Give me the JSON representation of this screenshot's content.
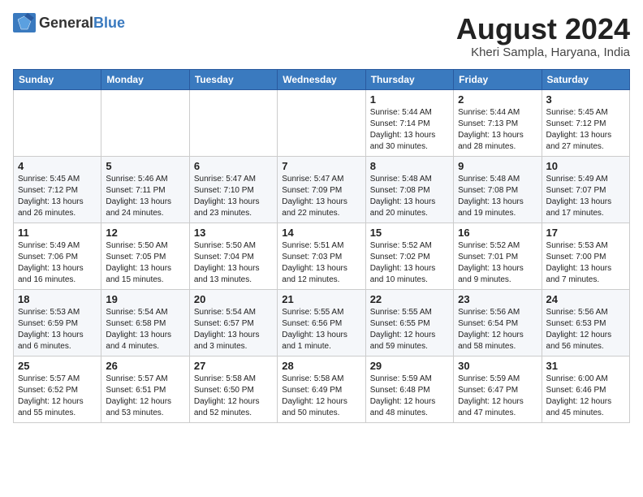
{
  "logo": {
    "text1": "General",
    "text2": "Blue"
  },
  "header": {
    "month_year": "August 2024",
    "location": "Kheri Sampla, Haryana, India"
  },
  "days_of_week": [
    "Sunday",
    "Monday",
    "Tuesday",
    "Wednesday",
    "Thursday",
    "Friday",
    "Saturday"
  ],
  "weeks": [
    [
      {
        "day": "",
        "content": ""
      },
      {
        "day": "",
        "content": ""
      },
      {
        "day": "",
        "content": ""
      },
      {
        "day": "",
        "content": ""
      },
      {
        "day": "1",
        "content": "Sunrise: 5:44 AM\nSunset: 7:14 PM\nDaylight: 13 hours\nand 30 minutes."
      },
      {
        "day": "2",
        "content": "Sunrise: 5:44 AM\nSunset: 7:13 PM\nDaylight: 13 hours\nand 28 minutes."
      },
      {
        "day": "3",
        "content": "Sunrise: 5:45 AM\nSunset: 7:12 PM\nDaylight: 13 hours\nand 27 minutes."
      }
    ],
    [
      {
        "day": "4",
        "content": "Sunrise: 5:45 AM\nSunset: 7:12 PM\nDaylight: 13 hours\nand 26 minutes."
      },
      {
        "day": "5",
        "content": "Sunrise: 5:46 AM\nSunset: 7:11 PM\nDaylight: 13 hours\nand 24 minutes."
      },
      {
        "day": "6",
        "content": "Sunrise: 5:47 AM\nSunset: 7:10 PM\nDaylight: 13 hours\nand 23 minutes."
      },
      {
        "day": "7",
        "content": "Sunrise: 5:47 AM\nSunset: 7:09 PM\nDaylight: 13 hours\nand 22 minutes."
      },
      {
        "day": "8",
        "content": "Sunrise: 5:48 AM\nSunset: 7:08 PM\nDaylight: 13 hours\nand 20 minutes."
      },
      {
        "day": "9",
        "content": "Sunrise: 5:48 AM\nSunset: 7:08 PM\nDaylight: 13 hours\nand 19 minutes."
      },
      {
        "day": "10",
        "content": "Sunrise: 5:49 AM\nSunset: 7:07 PM\nDaylight: 13 hours\nand 17 minutes."
      }
    ],
    [
      {
        "day": "11",
        "content": "Sunrise: 5:49 AM\nSunset: 7:06 PM\nDaylight: 13 hours\nand 16 minutes."
      },
      {
        "day": "12",
        "content": "Sunrise: 5:50 AM\nSunset: 7:05 PM\nDaylight: 13 hours\nand 15 minutes."
      },
      {
        "day": "13",
        "content": "Sunrise: 5:50 AM\nSunset: 7:04 PM\nDaylight: 13 hours\nand 13 minutes."
      },
      {
        "day": "14",
        "content": "Sunrise: 5:51 AM\nSunset: 7:03 PM\nDaylight: 13 hours\nand 12 minutes."
      },
      {
        "day": "15",
        "content": "Sunrise: 5:52 AM\nSunset: 7:02 PM\nDaylight: 13 hours\nand 10 minutes."
      },
      {
        "day": "16",
        "content": "Sunrise: 5:52 AM\nSunset: 7:01 PM\nDaylight: 13 hours\nand 9 minutes."
      },
      {
        "day": "17",
        "content": "Sunrise: 5:53 AM\nSunset: 7:00 PM\nDaylight: 13 hours\nand 7 minutes."
      }
    ],
    [
      {
        "day": "18",
        "content": "Sunrise: 5:53 AM\nSunset: 6:59 PM\nDaylight: 13 hours\nand 6 minutes."
      },
      {
        "day": "19",
        "content": "Sunrise: 5:54 AM\nSunset: 6:58 PM\nDaylight: 13 hours\nand 4 minutes."
      },
      {
        "day": "20",
        "content": "Sunrise: 5:54 AM\nSunset: 6:57 PM\nDaylight: 13 hours\nand 3 minutes."
      },
      {
        "day": "21",
        "content": "Sunrise: 5:55 AM\nSunset: 6:56 PM\nDaylight: 13 hours\nand 1 minute."
      },
      {
        "day": "22",
        "content": "Sunrise: 5:55 AM\nSunset: 6:55 PM\nDaylight: 12 hours\nand 59 minutes."
      },
      {
        "day": "23",
        "content": "Sunrise: 5:56 AM\nSunset: 6:54 PM\nDaylight: 12 hours\nand 58 minutes."
      },
      {
        "day": "24",
        "content": "Sunrise: 5:56 AM\nSunset: 6:53 PM\nDaylight: 12 hours\nand 56 minutes."
      }
    ],
    [
      {
        "day": "25",
        "content": "Sunrise: 5:57 AM\nSunset: 6:52 PM\nDaylight: 12 hours\nand 55 minutes."
      },
      {
        "day": "26",
        "content": "Sunrise: 5:57 AM\nSunset: 6:51 PM\nDaylight: 12 hours\nand 53 minutes."
      },
      {
        "day": "27",
        "content": "Sunrise: 5:58 AM\nSunset: 6:50 PM\nDaylight: 12 hours\nand 52 minutes."
      },
      {
        "day": "28",
        "content": "Sunrise: 5:58 AM\nSunset: 6:49 PM\nDaylight: 12 hours\nand 50 minutes."
      },
      {
        "day": "29",
        "content": "Sunrise: 5:59 AM\nSunset: 6:48 PM\nDaylight: 12 hours\nand 48 minutes."
      },
      {
        "day": "30",
        "content": "Sunrise: 5:59 AM\nSunset: 6:47 PM\nDaylight: 12 hours\nand 47 minutes."
      },
      {
        "day": "31",
        "content": "Sunrise: 6:00 AM\nSunset: 6:46 PM\nDaylight: 12 hours\nand 45 minutes."
      }
    ]
  ]
}
